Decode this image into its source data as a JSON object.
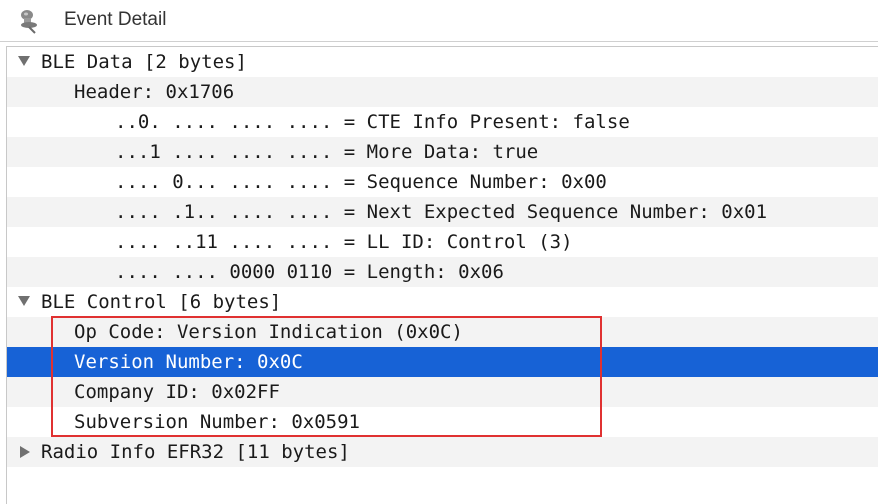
{
  "window": {
    "title": "Event Detail",
    "icon": "pushpin-icon"
  },
  "tree": {
    "rows": [
      {
        "text": "BLE Data [2 bytes]",
        "toggle": "expanded"
      },
      {
        "text": "Header: 0x1706"
      },
      {
        "text": "..0. .... .... .... = CTE Info Present: false"
      },
      {
        "text": "...1 .... .... .... = More Data: true"
      },
      {
        "text": ".... 0... .... .... = Sequence Number: 0x00"
      },
      {
        "text": ".... .1.. .... .... = Next Expected Sequence Number: 0x01"
      },
      {
        "text": ".... ..11 .... .... = LL ID: Control (3)"
      },
      {
        "text": ".... .... 0000 0110 = Length: 0x06"
      },
      {
        "text": "BLE Control [6 bytes]",
        "toggle": "expanded"
      },
      {
        "text": "Op Code: Version Indication (0x0C)"
      },
      {
        "text": "Version Number: 0x0C",
        "selected": true
      },
      {
        "text": "Company ID: 0x02FF"
      },
      {
        "text": "Subversion Number: 0x0591"
      },
      {
        "text": "Radio Info EFR32 [11 bytes]",
        "toggle": "collapsed"
      }
    ]
  },
  "colors": {
    "selection": "#1762d6",
    "stripe": "#f3f3f3",
    "annotation": "#e03131"
  }
}
